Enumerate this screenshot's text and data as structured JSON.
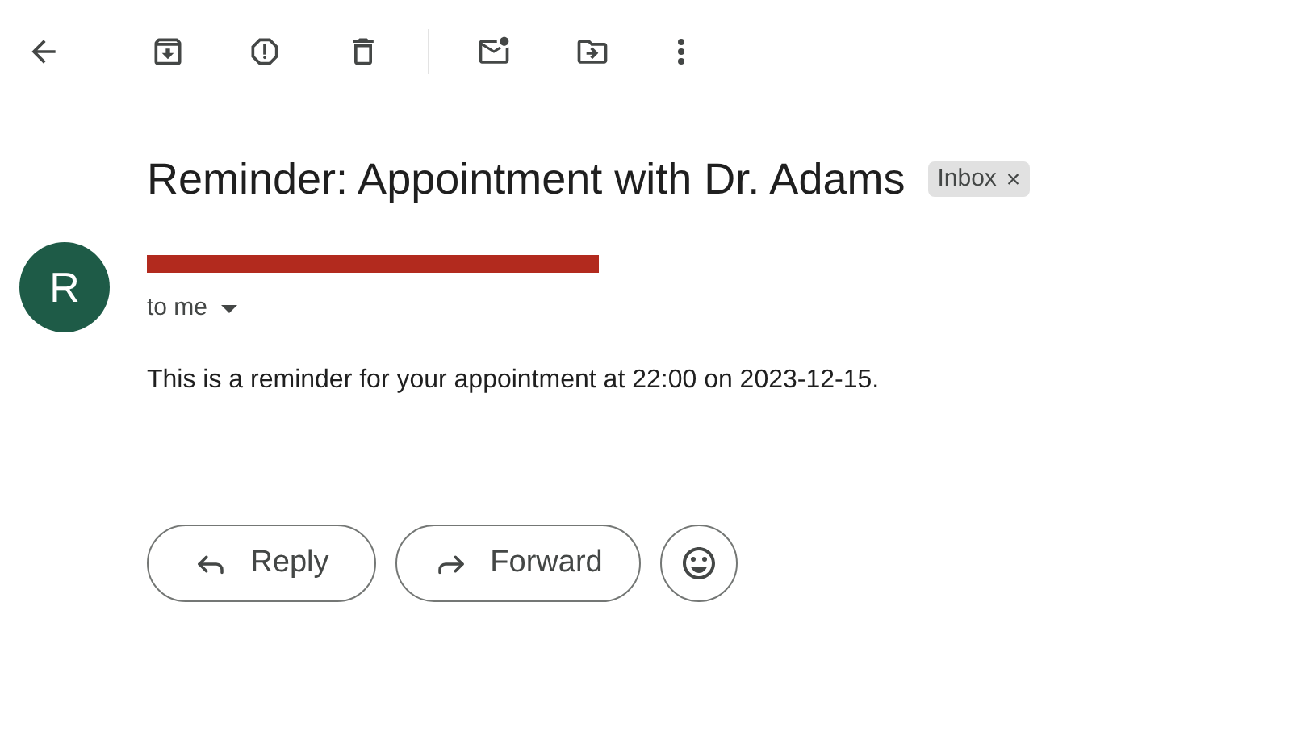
{
  "subject": "Reminder: Appointment with Dr. Adams",
  "label": {
    "text": "Inbox",
    "remove": "×"
  },
  "sender": {
    "avatar": "R",
    "recipient": "to me"
  },
  "body": "This is a reminder for your appointment at 22:00 on 2023-12-15.",
  "actions": [
    {
      "kind": "reply",
      "label": "Reply"
    },
    {
      "kind": "forward",
      "label": "Forward"
    },
    {
      "kind": "emoji"
    }
  ]
}
